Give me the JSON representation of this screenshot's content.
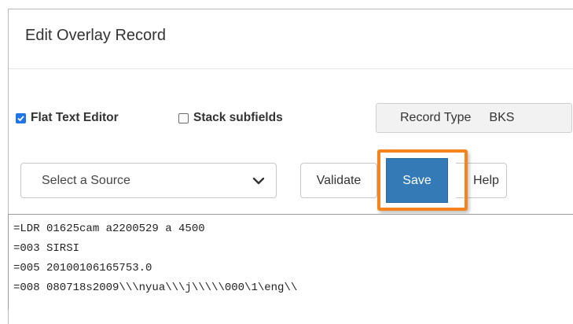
{
  "dialog": {
    "title": "Edit Overlay Record"
  },
  "options": {
    "flat_text_editor": {
      "label": "Flat Text Editor",
      "checked": true
    },
    "stack_subfields": {
      "label": "Stack subfields",
      "checked": false
    }
  },
  "record_type": {
    "label": "Record Type",
    "value": "BKS"
  },
  "source_select": {
    "selected": "Select a Source",
    "icon": "chevron-down-icon"
  },
  "buttons": {
    "validate": "Validate",
    "save": "Save",
    "help": "Help"
  },
  "colors": {
    "save_bg": "#337ab7",
    "highlight": "#f5841f",
    "checkbox": "#1f75e6"
  },
  "editor": {
    "lines": [
      "=LDR 01625cam a2200529 a 4500",
      "=003 SIRSI",
      "=005 20100106165753.0",
      "=008 080718s2009\\\\\\nyua\\\\\\j\\\\\\\\\\000\\1\\eng\\\\"
    ]
  }
}
